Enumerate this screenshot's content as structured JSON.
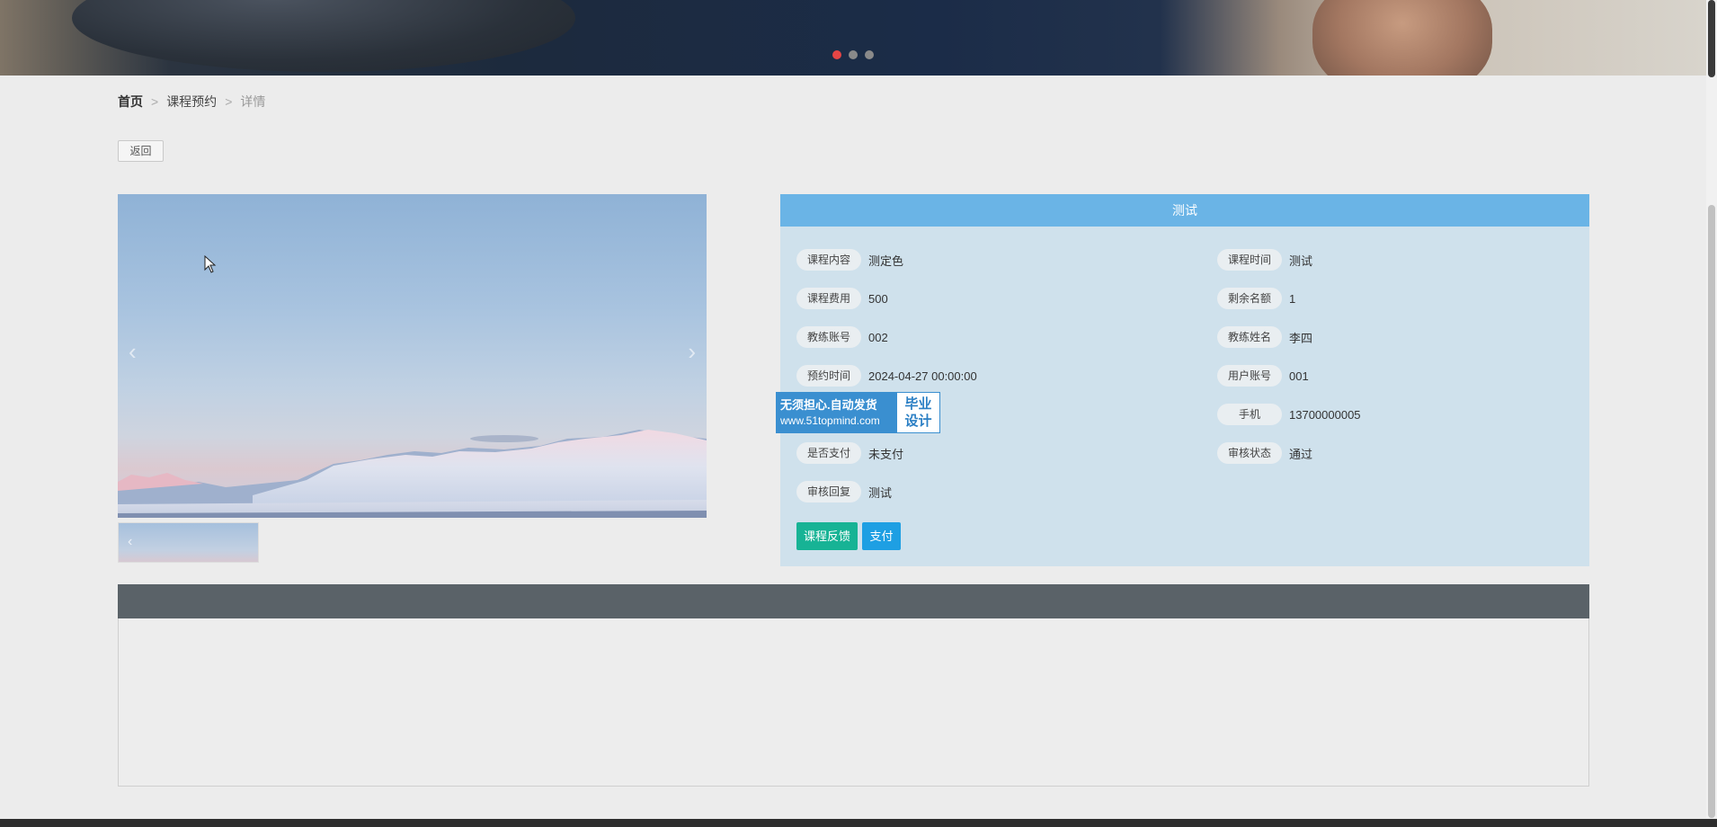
{
  "banner": {
    "dots": [
      {
        "active": true
      },
      {
        "active": false
      },
      {
        "active": false
      }
    ]
  },
  "breadcrumb": {
    "home": "首页",
    "separator": ">",
    "section": "课程预约",
    "current": "详情"
  },
  "back_button": "返回",
  "gallery": {
    "prev_arrow": "‹",
    "next_arrow": "›"
  },
  "panel": {
    "title": "测试",
    "fields_left": [
      {
        "label": "课程内容",
        "value": "测定色"
      },
      {
        "label": "课程费用",
        "value": "500"
      },
      {
        "label": "教练账号",
        "value": "002"
      },
      {
        "label": "预约时间",
        "value": "2024-04-27 00:00:00"
      },
      {
        "label": "是否支付",
        "value": "未支付"
      },
      {
        "label": "审核回复",
        "value": "测试"
      }
    ],
    "fields_right": [
      {
        "label": "课程时间",
        "value": "测试"
      },
      {
        "label": "剩余名额",
        "value": "1"
      },
      {
        "label": "教练姓名",
        "value": "李四"
      },
      {
        "label": "用户账号",
        "value": "001"
      },
      {
        "label": "手机",
        "value": "13700000005"
      },
      {
        "label": "审核状态",
        "value": "通过"
      }
    ],
    "feedback_button": "课程反馈",
    "pay_button": "支付"
  },
  "watermark": {
    "line1": "无须担心.自动发货",
    "line2": "www.51topmind.com",
    "right_line1": "毕业",
    "right_line2": "设计"
  },
  "colors": {
    "panel_header": "#6ab4e6",
    "panel_bg": "#cfe1ec",
    "feedback_button": "#17b395",
    "pay_button": "#1e9fe3",
    "bottom_header": "#5a6268"
  }
}
